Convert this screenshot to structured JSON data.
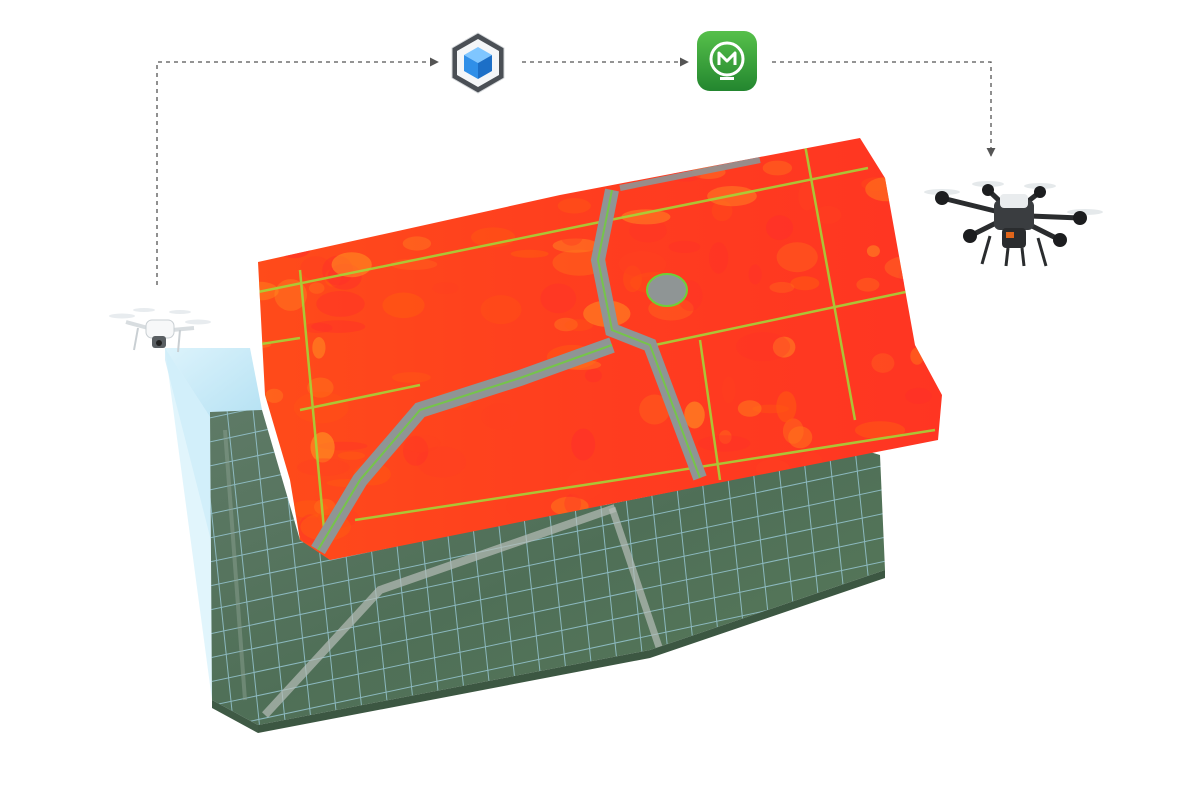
{
  "diagram": {
    "workflow_steps": [
      {
        "id": "survey-drone",
        "kind": "multispectral survey drone"
      },
      {
        "id": "mapping-software",
        "kind": "cube logo app icon"
      },
      {
        "id": "agriculture-app",
        "kind": "green app icon"
      },
      {
        "id": "spray-drone",
        "kind": "agricultural spraying drone"
      }
    ],
    "connectors": [
      {
        "from": "survey-drone",
        "to": "mapping-software",
        "style": "dashed-arrow"
      },
      {
        "from": "mapping-software",
        "to": "agriculture-app",
        "style": "dashed-arrow"
      },
      {
        "from": "agriculture-app",
        "to": "spray-drone",
        "style": "dashed-arrow"
      }
    ],
    "layers": [
      {
        "id": "ndvi-map",
        "kind": "vegetation index heatmap"
      },
      {
        "id": "rgb-orthophoto",
        "kind": "satellite-style field photo with grid"
      }
    ],
    "icons": [
      "cube-logo-icon",
      "agriculture-app-icon"
    ],
    "colors": {
      "ndvi_main": "#ff3d1f",
      "ndvi_mid": "#ff7a1a",
      "ndvi_low": "#8ad534",
      "road_gray": "#8f9595",
      "ortho_green": "#56735e",
      "grid_line": "#9fd0e0",
      "scan_beam": "#bfe6f7",
      "connector": "#555555",
      "agras_green": "#2e9e3c",
      "terra_blue": "#2f8fe8"
    }
  }
}
